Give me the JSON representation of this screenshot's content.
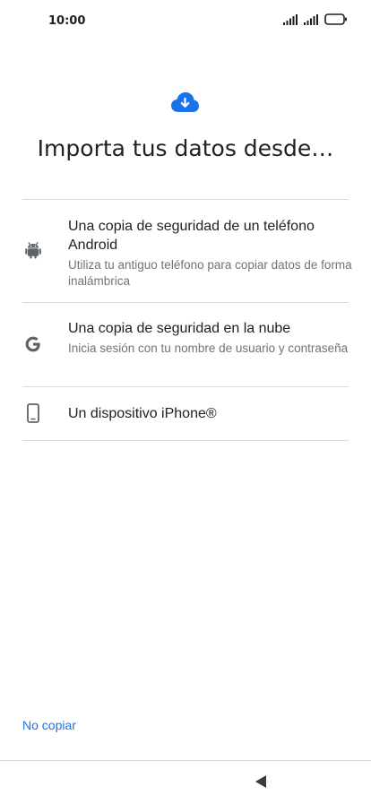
{
  "status_bar": {
    "time": "10:00",
    "icons": [
      "signal-1-icon",
      "signal-2-icon",
      "battery-icon"
    ]
  },
  "header": {
    "icon": "cloud-download-icon",
    "title": "Importa tus datos desde…"
  },
  "options": [
    {
      "icon": "android-icon",
      "title": "Una copia de seguridad de un teléfono Android",
      "subtitle": "Utiliza tu antiguo teléfono para copiar datos de forma inalámbrica"
    },
    {
      "icon": "google-icon",
      "title": "Una copia de seguridad en la nube",
      "subtitle": "Inicia sesión con tu nombre de usuario y contraseña"
    },
    {
      "icon": "phone-icon",
      "title": "Un dispositivo iPhone®",
      "subtitle": ""
    }
  ],
  "footer": {
    "no_copy_label": "No copiar"
  },
  "nav_bar": {
    "back_icon": "back-triangle-icon"
  },
  "colors": {
    "accent": "#1a73e8",
    "icon_gray": "#5f6368",
    "divider": "#dcdcdc"
  }
}
